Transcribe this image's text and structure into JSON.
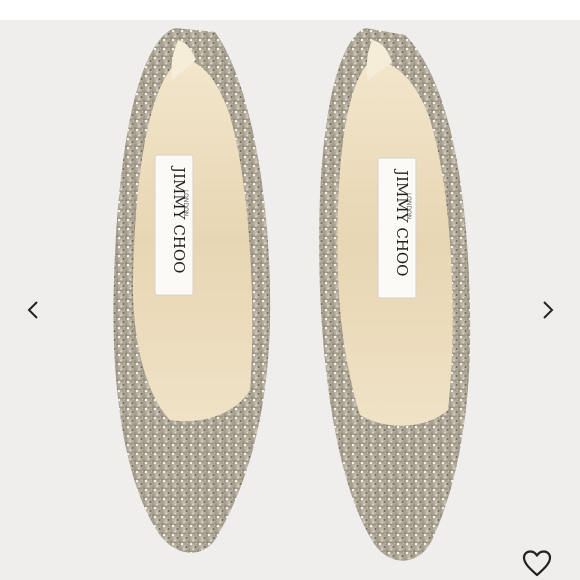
{
  "gallery": {
    "image": {
      "icon": "jimmy-choo-glitter-pumps",
      "label_brand": "JIMMY CHOO",
      "label_city": "LONDON"
    },
    "prev_icon": "chevron-left-icon",
    "next_icon": "chevron-right-icon",
    "favorite_icon": "heart-outline-icon"
  },
  "colors": {
    "background": "#efeeec",
    "glitter": "#b8b1a2",
    "lining": "#e6d5b4",
    "icon": "#222222"
  }
}
